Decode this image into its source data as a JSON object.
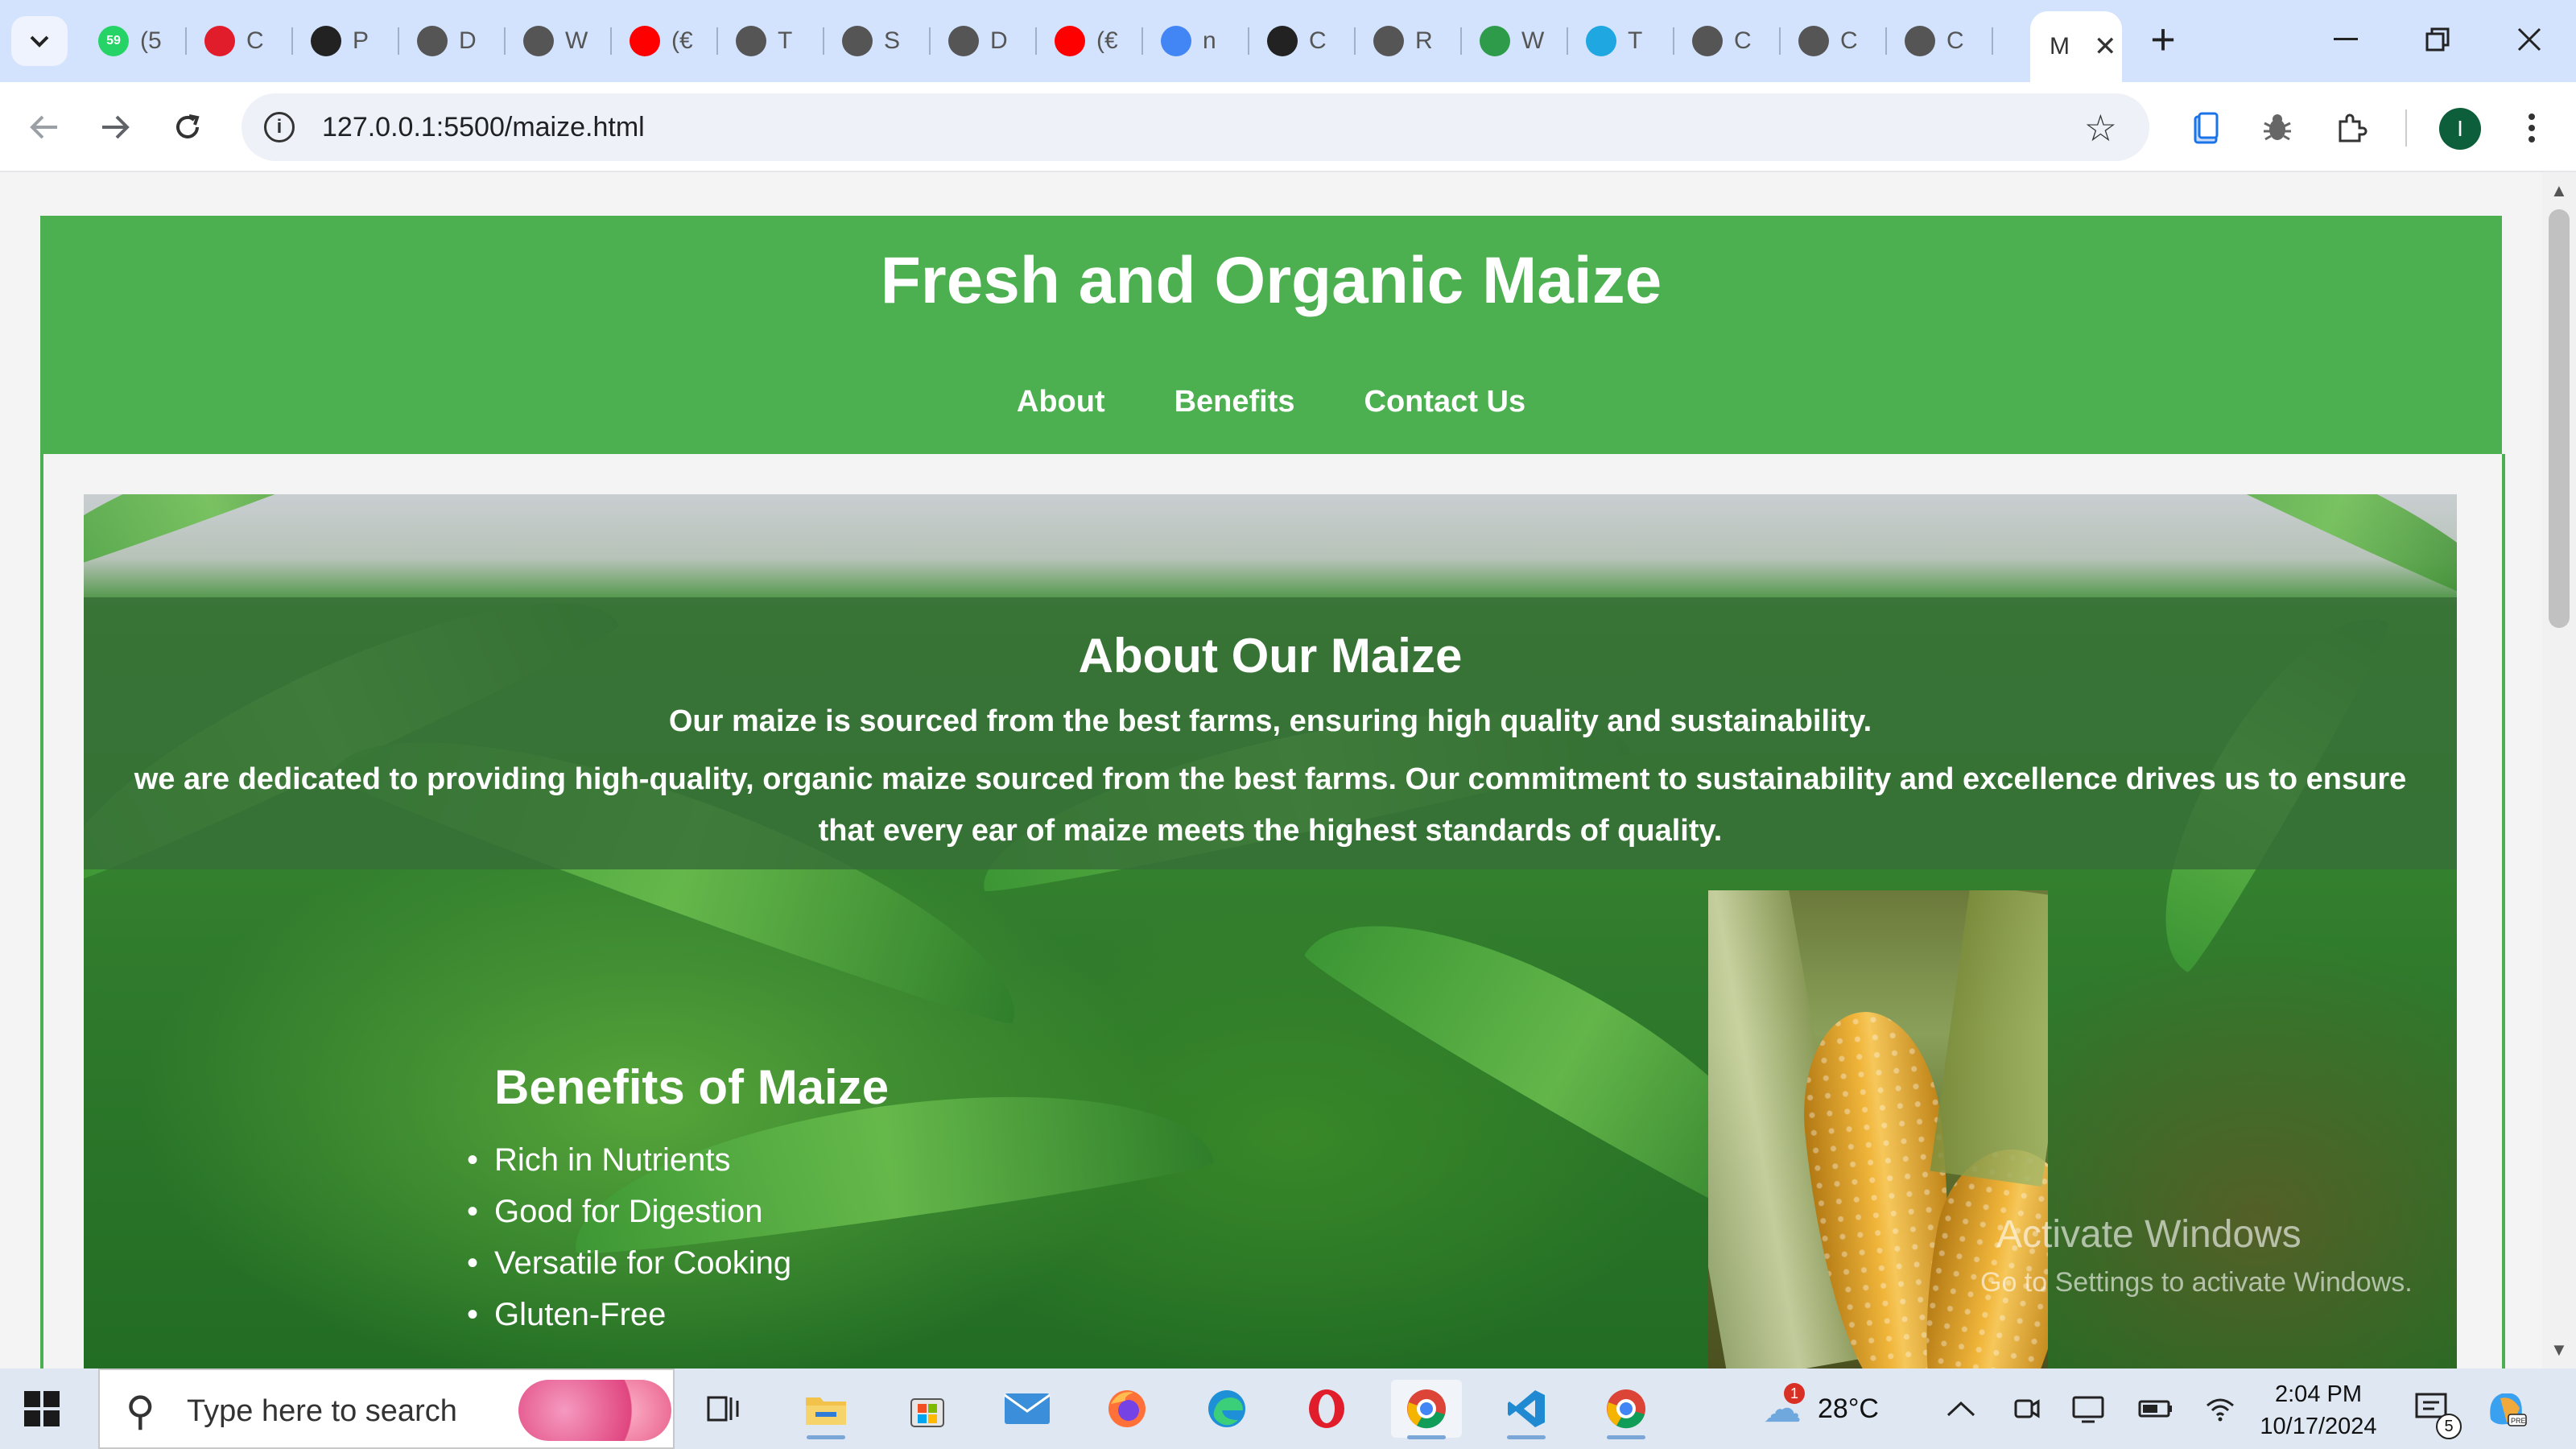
{
  "browser": {
    "tabs": [
      {
        "initial": "(5",
        "favicon": "whatsapp-icon",
        "color": "#25d366",
        "badge": "59"
      },
      {
        "initial": "C",
        "favicon": "opera-icon",
        "color": "#e11d2b"
      },
      {
        "initial": "P",
        "favicon": "github-icon",
        "color": "#222222"
      },
      {
        "initial": "D",
        "favicon": "globe-icon",
        "color": "#555555"
      },
      {
        "initial": "W",
        "favicon": "globe-icon",
        "color": "#555555"
      },
      {
        "initial": "(€",
        "favicon": "youtube-icon",
        "color": "#ff0000"
      },
      {
        "initial": "T",
        "favicon": "globe-icon",
        "color": "#555555"
      },
      {
        "initial": "S",
        "favicon": "globe-icon",
        "color": "#555555"
      },
      {
        "initial": "D",
        "favicon": "globe-icon",
        "color": "#555555"
      },
      {
        "initial": "(€",
        "favicon": "youtube-icon",
        "color": "#ff0000"
      },
      {
        "initial": "n",
        "favicon": "google-icon",
        "color": "#4285f4"
      },
      {
        "initial": "C",
        "favicon": "chatgpt-icon",
        "color": "#222222"
      },
      {
        "initial": "R",
        "favicon": "globe-icon",
        "color": "#555555"
      },
      {
        "initial": "W",
        "favicon": "pinwheel-icon",
        "color": "#2e9b4a"
      },
      {
        "initial": "T",
        "favicon": "wave-icon",
        "color": "#1ea7e1"
      },
      {
        "initial": "C",
        "favicon": "globe-icon",
        "color": "#555555"
      },
      {
        "initial": "C",
        "favicon": "globe-icon",
        "color": "#555555"
      },
      {
        "initial": "C",
        "favicon": "globe-icon",
        "color": "#555555"
      }
    ],
    "active_tab": {
      "initial": "M",
      "close": "✕"
    },
    "new_tab": "+",
    "url": "127.0.0.1:5500/maize.html"
  },
  "page": {
    "title": "Fresh and Organic Maize",
    "nav": [
      "About",
      "Benefits",
      "Contact Us"
    ],
    "about": {
      "heading": "About Our Maize",
      "lead": "Our maize is sourced from the best farms, ensuring high quality and sustainability.",
      "body": "we are dedicated to providing high-quality, organic maize sourced from the best farms. Our commitment to sustainability and excellence drives us to ensure that every ear of maize meets the highest standards of quality."
    },
    "benefits": {
      "heading": "Benefits of Maize",
      "items": [
        "Rich in Nutrients",
        "Good for Digestion",
        "Versatile for Cooking",
        "Gluten-Free"
      ]
    },
    "watermark": {
      "line1": "Activate Windows",
      "line2": "Go to Settings to activate Windows."
    },
    "header_color": "#4caf50"
  },
  "taskbar": {
    "search_placeholder": "Type here to search",
    "weather": "28°C",
    "weather_badge": "1",
    "time": "2:04 PM",
    "date": "10/17/2024",
    "notifications": "5"
  }
}
